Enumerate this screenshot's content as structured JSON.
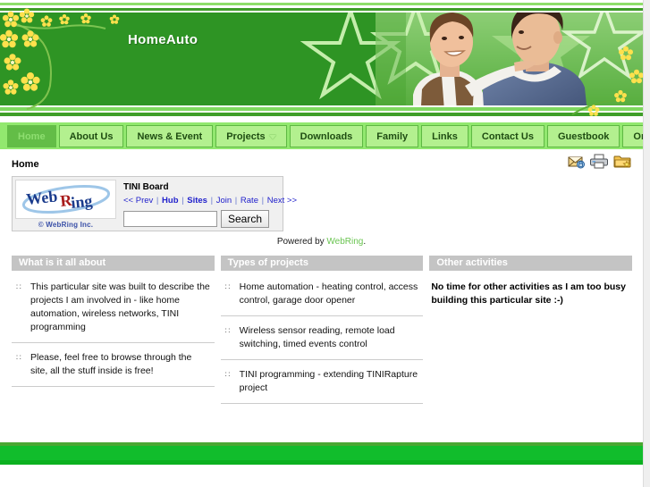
{
  "site": {
    "title": "HomeAuto"
  },
  "nav": {
    "items": [
      {
        "label": "Home",
        "active": true,
        "has_caret": false
      },
      {
        "label": "About Us",
        "active": false,
        "has_caret": false
      },
      {
        "label": "News & Event",
        "active": false,
        "has_caret": false
      },
      {
        "label": "Projects",
        "active": false,
        "has_caret": true
      },
      {
        "label": "Downloads",
        "active": false,
        "has_caret": false
      },
      {
        "label": "Family",
        "active": false,
        "has_caret": false
      },
      {
        "label": "Links",
        "active": false,
        "has_caret": false
      },
      {
        "label": "Contact Us",
        "active": false,
        "has_caret": false
      },
      {
        "label": "Guestbook",
        "active": false,
        "has_caret": false
      },
      {
        "label": "Online Form",
        "active": false,
        "has_caret": false
      }
    ]
  },
  "breadcrumb": {
    "text": "Home"
  },
  "tools": {
    "icons": [
      {
        "name": "email-icon",
        "title": "Email this page"
      },
      {
        "name": "print-icon",
        "title": "Print this page"
      },
      {
        "name": "bookmark-folder-icon",
        "title": "Add to favorites"
      }
    ]
  },
  "webring": {
    "logo_text_web": "Web",
    "logo_text_ring": "Ring",
    "copyright": "© WebRing Inc.",
    "ring_name": "TINI Board",
    "links": [
      {
        "label": "<< Prev",
        "bold": false
      },
      {
        "label": "Hub",
        "bold": true
      },
      {
        "label": "Sites",
        "bold": true
      },
      {
        "label": "Join",
        "bold": false
      },
      {
        "label": "Rate",
        "bold": false
      },
      {
        "label": "Next >>",
        "bold": false
      }
    ],
    "separator": "|",
    "search_value": "",
    "search_placeholder": "",
    "search_button": "Search",
    "powered_prefix": "Powered by ",
    "powered_link": "WebRing",
    "powered_suffix": "."
  },
  "columns": [
    {
      "heading": "What is it all about",
      "items": [
        {
          "bullet": "∷",
          "text": "This particular site was built to describe the projects I am involved in - like home automation, wireless networks, TINI programming"
        },
        {
          "bullet": "∷",
          "text": "Please, feel free to browse through the site, all the stuff inside is free!"
        }
      ],
      "note": ""
    },
    {
      "heading": "Types of projects",
      "items": [
        {
          "bullet": "∷",
          "text": "Home automation - heating control, access control, garage door opener"
        },
        {
          "bullet": "∷",
          "text": "Wireless sensor reading, remote load switching, timed events control"
        },
        {
          "bullet": "∷",
          "text": "TINI programming - extending TINIRapture project"
        }
      ],
      "note": ""
    },
    {
      "heading": "Other activities",
      "items": [],
      "note": "No time for other activities as I am too busy building this particular site :-)"
    }
  ],
  "colors": {
    "banner_green": "#2e9424",
    "nav_bar_green": "#92e86f",
    "nav_item_green": "#b3f08f",
    "nav_active_green": "#63bd47",
    "footer_green": "#11bd2c",
    "heading_grey": "#c4c4c4",
    "link_blue": "#2222cc",
    "webring_link_green": "#69c450"
  }
}
